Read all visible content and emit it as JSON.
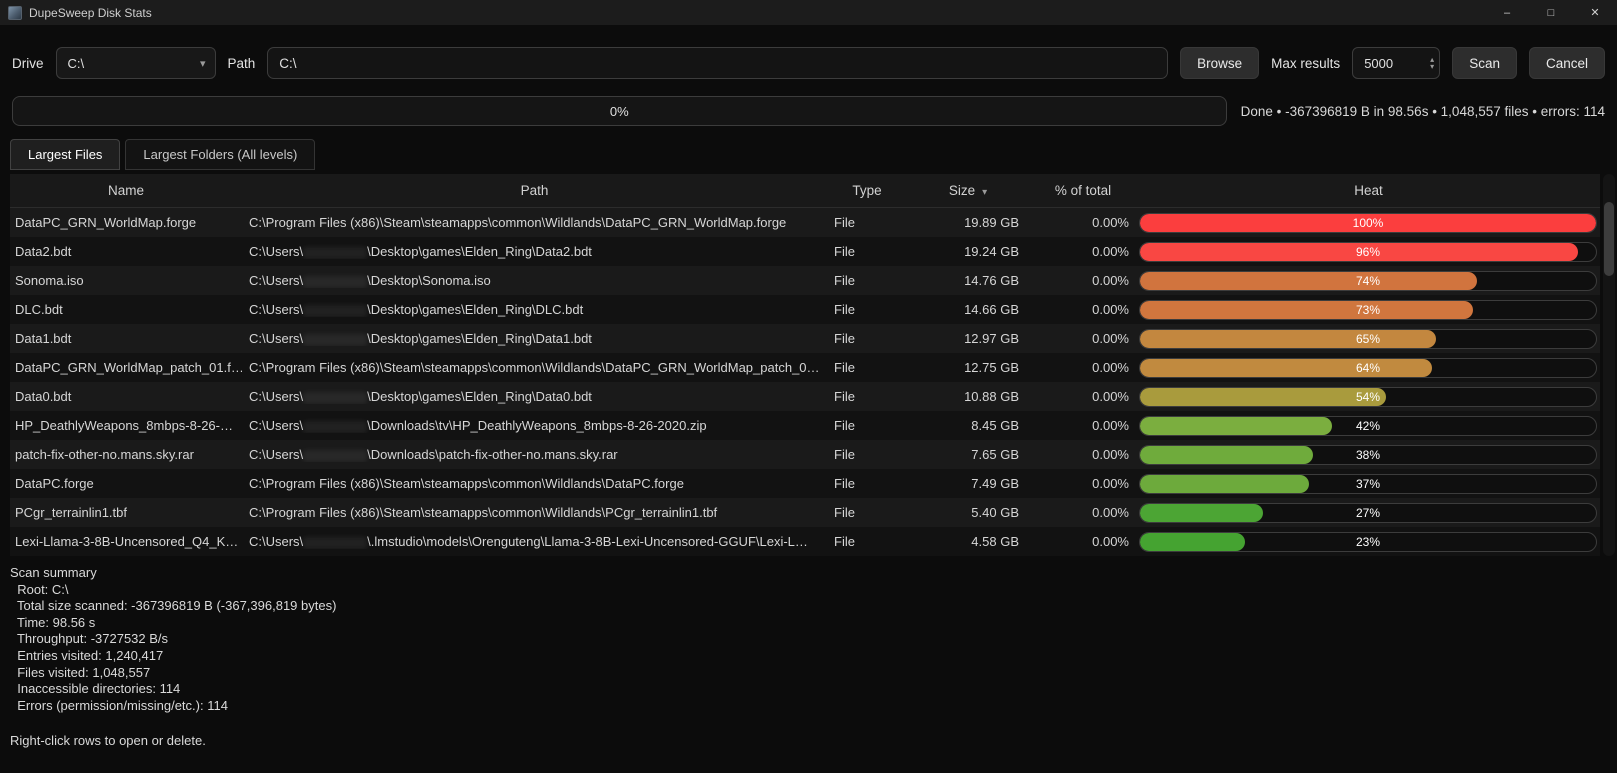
{
  "window": {
    "title": "DupeSweep Disk Stats",
    "controls": {
      "minimize": "–",
      "maximize": "□",
      "close": "✕"
    }
  },
  "icons": {
    "chevron_down": "▾",
    "sort_down": "▾",
    "spin_up": "▴",
    "spin_down": "▾"
  },
  "toolbar": {
    "drive_label": "Drive",
    "drive_value": "C:\\",
    "path_label": "Path",
    "path_value": "C:\\",
    "browse_label": "Browse",
    "max_results_label": "Max results",
    "max_results_value": "5000",
    "scan_label": "Scan",
    "cancel_label": "Cancel"
  },
  "progress": {
    "percent_label": "0%",
    "status": "Done • -367396819 B in 98.56s • 1,048,557 files • errors: 114"
  },
  "tabs": [
    {
      "label": "Largest Files",
      "active": true
    },
    {
      "label": "Largest Folders (All levels)",
      "active": false
    }
  ],
  "table": {
    "columns": [
      "Name",
      "Path",
      "Type",
      "Size",
      "% of total",
      "Heat"
    ],
    "sort_column": "Size",
    "rows": [
      {
        "name": "DataPC_GRN_WorldMap.forge",
        "path_prefix": "C:\\Program Files (x86)\\Steam\\steamapps\\common\\Wildlands\\DataPC_GRN_WorldMap.forge",
        "path_redacted": false,
        "path_suffix": "",
        "type": "File",
        "size": "19.89 GB",
        "pct": "0.00%",
        "heat_pct": 100,
        "heat_label": "100%",
        "heat_color": "#fb3e3e"
      },
      {
        "name": "Data2.bdt",
        "path_prefix": "C:\\Users\\",
        "path_redacted": true,
        "path_suffix": "\\Desktop\\games\\Elden_Ring\\Data2.bdt",
        "type": "File",
        "size": "19.24 GB",
        "pct": "0.00%",
        "heat_pct": 96,
        "heat_label": "96%",
        "heat_color": "#f94743"
      },
      {
        "name": "Sonoma.iso",
        "path_prefix": "C:\\Users\\",
        "path_redacted": true,
        "path_suffix": "\\Desktop\\Sonoma.iso",
        "type": "File",
        "size": "14.76 GB",
        "pct": "0.00%",
        "heat_pct": 74,
        "heat_label": "74%",
        "heat_color": "#d1743e"
      },
      {
        "name": "DLC.bdt",
        "path_prefix": "C:\\Users\\",
        "path_redacted": true,
        "path_suffix": "\\Desktop\\games\\Elden_Ring\\DLC.bdt",
        "type": "File",
        "size": "14.66 GB",
        "pct": "0.00%",
        "heat_pct": 73,
        "heat_label": "73%",
        "heat_color": "#d0763e"
      },
      {
        "name": "Data1.bdt",
        "path_prefix": "C:\\Users\\",
        "path_redacted": true,
        "path_suffix": "\\Desktop\\games\\Elden_Ring\\Data1.bdt",
        "type": "File",
        "size": "12.97 GB",
        "pct": "0.00%",
        "heat_pct": 65,
        "heat_label": "65%",
        "heat_color": "#c3873f"
      },
      {
        "name": "DataPC_GRN_WorldMap_patch_01.f…",
        "path_prefix": "C:\\Program Files (x86)\\Steam\\steamapps\\common\\Wildlands\\DataPC_GRN_WorldMap_patch_0…",
        "path_redacted": false,
        "path_suffix": "",
        "type": "File",
        "size": "12.75 GB",
        "pct": "0.00%",
        "heat_pct": 64,
        "heat_label": "64%",
        "heat_color": "#c18a3f"
      },
      {
        "name": "Data0.bdt",
        "path_prefix": "C:\\Users\\",
        "path_redacted": true,
        "path_suffix": "\\Desktop\\games\\Elden_Ring\\Data0.bdt",
        "type": "File",
        "size": "10.88 GB",
        "pct": "0.00%",
        "heat_pct": 54,
        "heat_label": "54%",
        "heat_color": "#a99b3d"
      },
      {
        "name": "HP_DeathlyWeapons_8mbps-8-26-…",
        "path_prefix": "C:\\Users\\",
        "path_redacted": true,
        "path_suffix": "\\Downloads\\tv\\HP_DeathlyWeapons_8mbps-8-26-2020.zip",
        "type": "File",
        "size": "8.45 GB",
        "pct": "0.00%",
        "heat_pct": 42,
        "heat_label": "42%",
        "heat_color": "#7bae3f"
      },
      {
        "name": "patch-fix-other-no.mans.sky.rar",
        "path_prefix": "C:\\Users\\",
        "path_redacted": true,
        "path_suffix": "\\Downloads\\patch-fix-other-no.mans.sky.rar",
        "type": "File",
        "size": "7.65 GB",
        "pct": "0.00%",
        "heat_pct": 38,
        "heat_label": "38%",
        "heat_color": "#6fab3c"
      },
      {
        "name": "DataPC.forge",
        "path_prefix": "C:\\Program Files (x86)\\Steam\\steamapps\\common\\Wildlands\\DataPC.forge",
        "path_redacted": false,
        "path_suffix": "",
        "type": "File",
        "size": "7.49 GB",
        "pct": "0.00%",
        "heat_pct": 37,
        "heat_label": "37%",
        "heat_color": "#6daa3c"
      },
      {
        "name": "PCgr_terrainlin1.tbf",
        "path_prefix": "C:\\Program Files (x86)\\Steam\\steamapps\\common\\Wildlands\\PCgr_terrainlin1.tbf",
        "path_redacted": false,
        "path_suffix": "",
        "type": "File",
        "size": "5.40 GB",
        "pct": "0.00%",
        "heat_pct": 27,
        "heat_label": "27%",
        "heat_color": "#4ca534"
      },
      {
        "name": "Lexi-Llama-3-8B-Uncensored_Q4_K…",
        "path_prefix": "C:\\Users\\",
        "path_redacted": true,
        "path_suffix": "\\.lmstudio\\models\\Orenguteng\\Llama-3-8B-Lexi-Uncensored-GGUF\\Lexi-L…",
        "type": "File",
        "size": "4.58 GB",
        "pct": "0.00%",
        "heat_pct": 23,
        "heat_label": "23%",
        "heat_color": "#45a331"
      }
    ]
  },
  "summary": {
    "lines": [
      "Scan summary",
      "  Root: C:\\",
      "  Total size scanned: -367396819 B (-367,396,819 bytes)",
      "  Time: 98.56 s",
      "  Throughput: -3727532 B/s",
      "  Entries visited: 1,240,417",
      "  Files visited: 1,048,557",
      "  Inaccessible directories: 114",
      "  Errors (permission/missing/etc.): 114"
    ],
    "hint": "Right-click rows to open or delete."
  }
}
